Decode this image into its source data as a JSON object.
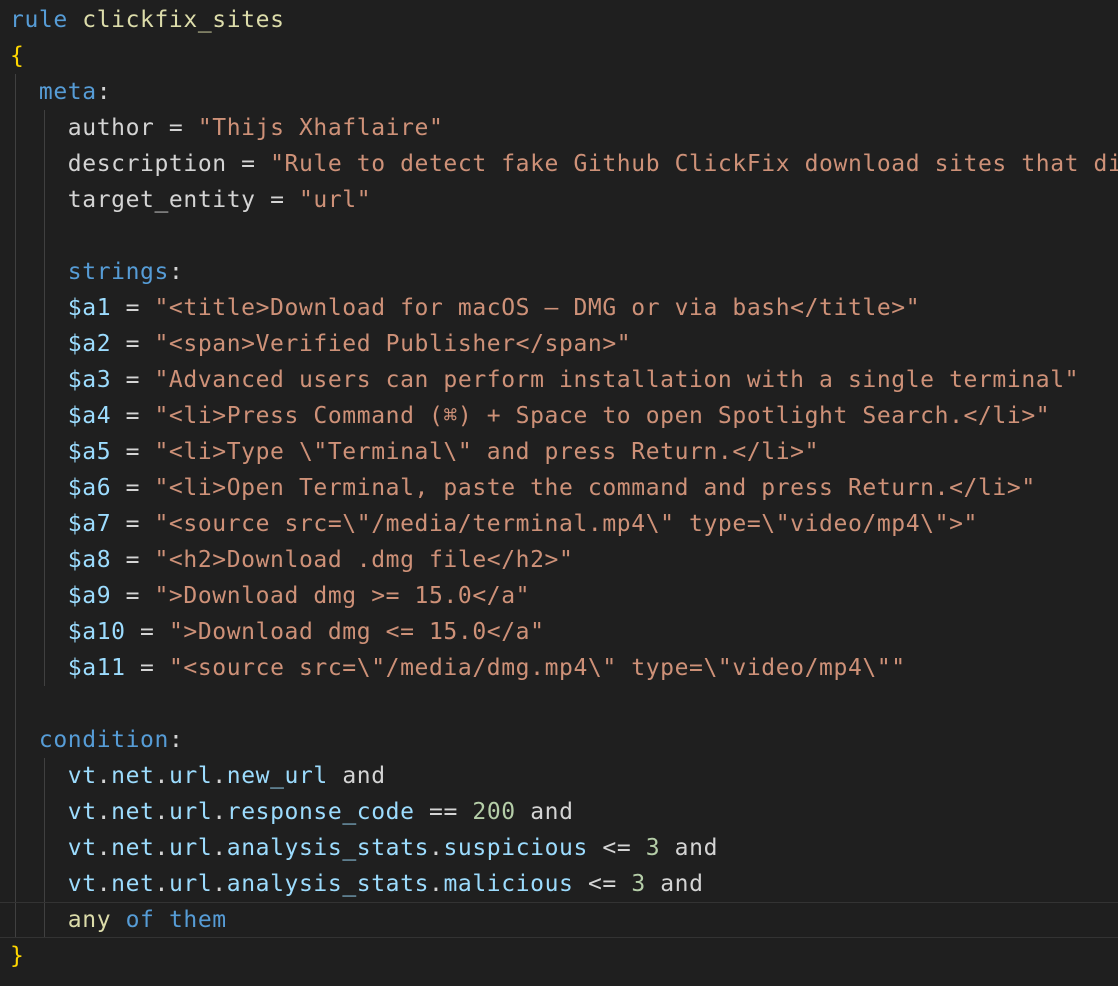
{
  "colors": {
    "background": "#1f1f1f",
    "keyword": "#569cd6",
    "identifier": "#dcdcaa",
    "variable": "#9cdcfe",
    "string": "#ce9178",
    "number": "#b5cea8",
    "brace": "#ffd700"
  },
  "code": {
    "rule_keyword": "rule",
    "rule_name": "clickfix_sites",
    "open_brace": "{",
    "close_brace": "}",
    "meta": {
      "section": "meta",
      "entries": [
        {
          "key": "author",
          "value": "\"Thijs Xhaflaire\""
        },
        {
          "key": "description",
          "value": "\"Rule to detect fake Github ClickFix download sites that di"
        },
        {
          "key": "target_entity",
          "value": "\"url\""
        }
      ]
    },
    "strings": {
      "section": "strings",
      "entries": [
        {
          "id": "$a1",
          "value": "\"<title>Download for macOS – DMG or via bash</title>\""
        },
        {
          "id": "$a2",
          "value": "\"<span>Verified Publisher</span>\""
        },
        {
          "id": "$a3",
          "value": "\"Advanced users can perform installation with a single terminal\""
        },
        {
          "id": "$a4",
          "value": "\"<li>Press Command (⌘) + Space to open Spotlight Search.</li>\""
        },
        {
          "id": "$a5",
          "value": "\"<li>Type \\\"Terminal\\\" and press Return.</li>\""
        },
        {
          "id": "$a6",
          "value": "\"<li>Open Terminal, paste the command and press Return.</li>\""
        },
        {
          "id": "$a7",
          "value": "\"<source src=\\\"/media/terminal.mp4\\\" type=\\\"video/mp4\\\">\""
        },
        {
          "id": "$a8",
          "value": "\"<h2>Download .dmg file</h2>\""
        },
        {
          "id": "$a9",
          "value": "\">Download dmg >= 15.0</a\""
        },
        {
          "id": "$a10",
          "value": "\">Download dmg <= 15.0</a\""
        },
        {
          "id": "$a11",
          "value": "\"<source src=\\\"/media/dmg.mp4\\\" type=\\\"video/mp4\\\"\""
        }
      ]
    },
    "condition": {
      "section": "condition",
      "lines": [
        {
          "path": [
            "vt",
            "net",
            "url",
            "new_url"
          ],
          "op": "",
          "num": "",
          "tail": "and"
        },
        {
          "path": [
            "vt",
            "net",
            "url",
            "response_code"
          ],
          "op": "==",
          "num": "200",
          "tail": "and"
        },
        {
          "path": [
            "vt",
            "net",
            "url",
            "analysis_stats",
            "suspicious"
          ],
          "op": "<=",
          "num": "3",
          "tail": "and"
        },
        {
          "path": [
            "vt",
            "net",
            "url",
            "analysis_stats",
            "malicious"
          ],
          "op": "<=",
          "num": "3",
          "tail": "and"
        }
      ],
      "final": {
        "any": "any",
        "of": "of",
        "them": "them"
      }
    }
  }
}
